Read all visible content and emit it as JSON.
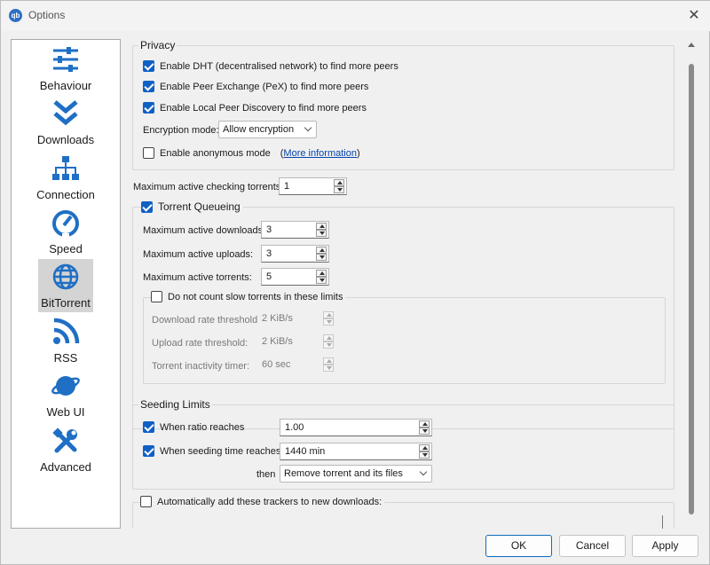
{
  "window": {
    "title": "Options",
    "app_icon": "qb"
  },
  "sidebar": {
    "items": [
      {
        "label": "Behaviour",
        "icon": "sliders-icon"
      },
      {
        "label": "Downloads",
        "icon": "double-chevron-down-icon"
      },
      {
        "label": "Connection",
        "icon": "network-tree-icon"
      },
      {
        "label": "Speed",
        "icon": "speedometer-icon"
      },
      {
        "label": "BitTorrent",
        "icon": "globe-icon",
        "active": true
      },
      {
        "label": "RSS",
        "icon": "rss-icon"
      },
      {
        "label": "Web UI",
        "icon": "planet-icon"
      },
      {
        "label": "Advanced",
        "icon": "tools-icon"
      }
    ]
  },
  "privacy": {
    "title": "Privacy",
    "dht": "Enable DHT (decentralised network) to find more peers",
    "pex": "Enable Peer Exchange (PeX) to find more peers",
    "lpd": "Enable Local Peer Discovery to find more peers",
    "encryption_label": "Encryption mode:",
    "encryption_value": "Allow encryption",
    "anonymous": "Enable anonymous mode",
    "more_info_open": "(",
    "more_info": "More information",
    "more_info_close": ")"
  },
  "checking": {
    "label": "Maximum active checking torrents:",
    "value": "1"
  },
  "queueing": {
    "title": "Torrent Queueing",
    "max_downloads_label": "Maximum active downloads:",
    "max_downloads": "3",
    "max_uploads_label": "Maximum active uploads:",
    "max_uploads": "3",
    "max_torrents_label": "Maximum active torrents:",
    "max_torrents": "5",
    "slow_title": "Do not count slow torrents in these limits",
    "dl_threshold_label": "Download rate threshold:",
    "dl_threshold": "2 KiB/s",
    "ul_threshold_label": "Upload rate threshold:",
    "ul_threshold": "2 KiB/s",
    "inactivity_label": "Torrent inactivity timer:",
    "inactivity": "60 sec"
  },
  "seeding": {
    "title": "Seeding Limits",
    "ratio_label": "When ratio reaches",
    "ratio": "1.00",
    "time_label": "When seeding time reaches",
    "time": "1440 min",
    "then_label": "then",
    "then_value": "Remove torrent and its files"
  },
  "trackers": {
    "label": "Automatically add these trackers to new downloads:"
  },
  "buttons": {
    "ok": "OK",
    "cancel": "Cancel",
    "apply": "Apply"
  }
}
